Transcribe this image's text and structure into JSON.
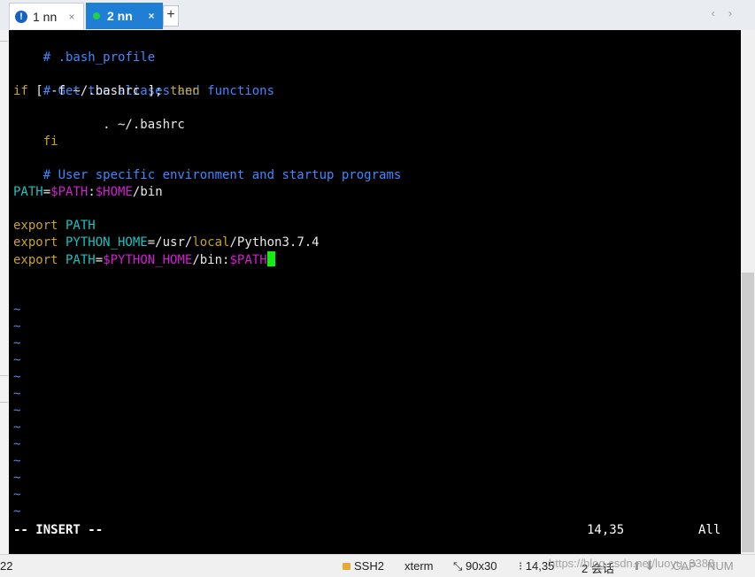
{
  "tabs": [
    {
      "label": "1 nn",
      "close": "×",
      "active": false
    },
    {
      "label": "2 nn",
      "close": "×",
      "active": true
    }
  ],
  "new_tab": "+",
  "tab_nav": "‹ ›",
  "terminal": {
    "l1": "# .bash_profile",
    "l2": "# Get the aliases and functions",
    "l3_if": "if",
    "l3_mid": " [ -f ~/.bashrc ]; ",
    "l3_then": "then",
    "l4": "        . ~/.bashrc",
    "l5": "fi",
    "l6": "# User specific environment and startup programs",
    "l7_name": "PATH",
    "l7_eq": "=",
    "l7_v1": "$PATH",
    "l7_colon": ":",
    "l7_v2": "$HOME",
    "l7_end": "/bin",
    "l8_kw": "export",
    "l8_name": " PATH",
    "l9_kw": "export",
    "l9_name": " PYTHON_HOME",
    "l9_eq": "=/usr/",
    "l9_local": "local",
    "l9_end": "/Python3.7.4",
    "l10_kw": "export",
    "l10_name": " PATH",
    "l10_eq": "=",
    "l10_v1": "$PYTHON_HOME",
    "l10_mid": "/bin:",
    "l10_v2": "$PATH",
    "tilde": "~",
    "mode": "-- INSERT --",
    "position": "14,35",
    "scroll": "All"
  },
  "statusbar": {
    "left": "22",
    "protocol": "SSH2",
    "term_type": "xterm",
    "size": "90x30",
    "cursor": "14,35",
    "sessions": "2 会话",
    "cap": "CAP",
    "num": "NUM",
    "watermark": "https://blog.csdn.net/luoyu_3388"
  },
  "colors": {
    "tab_active": "#1e7fd4",
    "comment": "#3f88ff",
    "keyword": "#c9a227",
    "identifier": "#19c2c2",
    "variable": "#d020d0",
    "cursor": "#12ee12"
  }
}
